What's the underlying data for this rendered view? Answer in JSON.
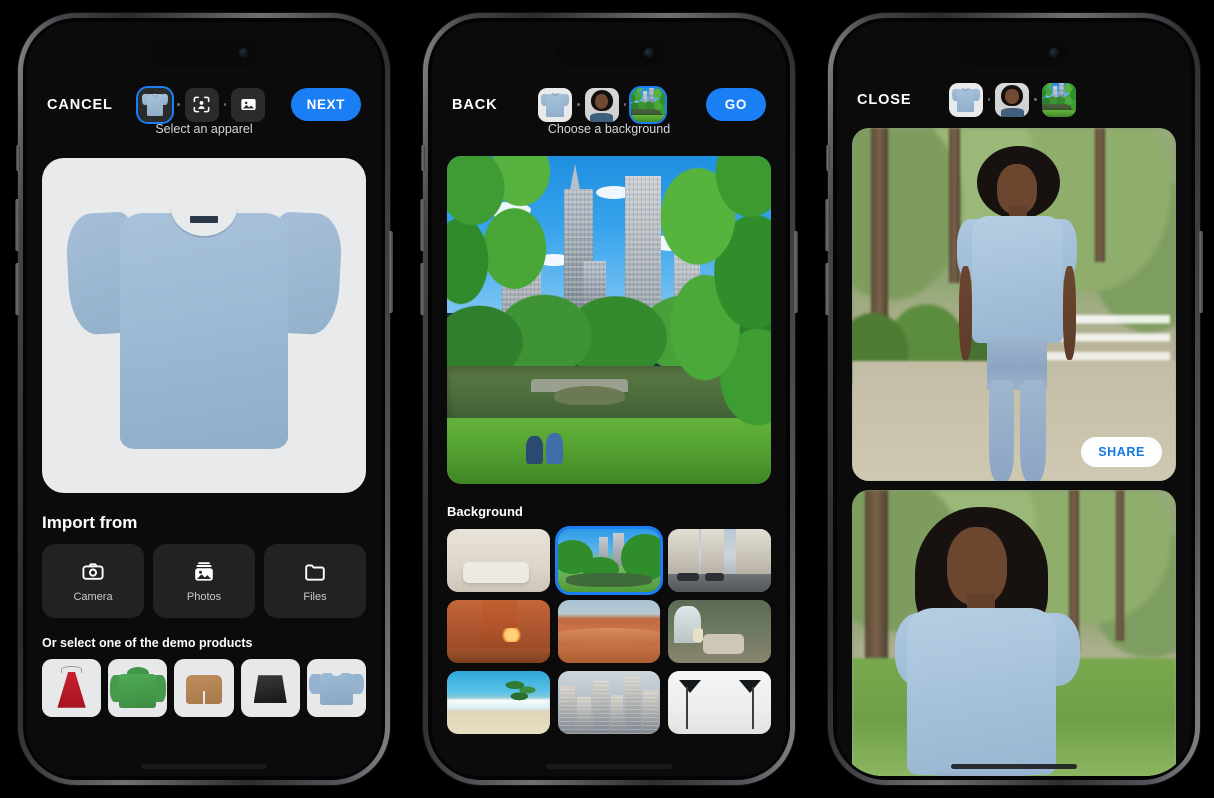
{
  "phones": [
    {
      "id": "apparel-select",
      "topbar": {
        "left_button": "CANCEL",
        "right_button": "NEXT",
        "caption": "Select an apparel",
        "steps": [
          {
            "name": "apparel",
            "selected": true,
            "icon": "tshirt-thumbnail"
          },
          {
            "name": "model",
            "selected": false,
            "icon": "person-frame-icon"
          },
          {
            "name": "background",
            "selected": false,
            "icon": "photo-icon"
          }
        ]
      },
      "preview": {
        "label": "blue t-shirt preview",
        "color": "#9dbad4",
        "card_bg": "#e9eaec"
      },
      "import": {
        "title": "Import from",
        "options": [
          {
            "label": "Camera",
            "icon": "camera-icon"
          },
          {
            "label": "Photos",
            "icon": "photos-icon"
          },
          {
            "label": "Files",
            "icon": "folder-icon"
          }
        ]
      },
      "demo": {
        "title": "Or select one of the demo products",
        "items": [
          {
            "label": "red dress",
            "kind": "dress"
          },
          {
            "label": "green hoodie",
            "kind": "hoodie"
          },
          {
            "label": "tan shorts",
            "kind": "shorts"
          },
          {
            "label": "black skirt",
            "kind": "skirt"
          },
          {
            "label": "blue t-shirt",
            "kind": "tee"
          }
        ]
      }
    },
    {
      "id": "background-select",
      "topbar": {
        "left_button": "BACK",
        "right_button": "GO",
        "caption": "Choose a background",
        "steps": [
          {
            "name": "apparel",
            "selected": false,
            "icon": "tshirt-thumbnail"
          },
          {
            "name": "model",
            "selected": false,
            "icon": "model-thumbnail"
          },
          {
            "name": "background",
            "selected": true,
            "icon": "park-thumbnail"
          }
        ]
      },
      "preview": {
        "label": "city park with lake and skyline"
      },
      "grid": {
        "title": "Background",
        "items": [
          {
            "label": "living room",
            "kind": "living",
            "selected": false
          },
          {
            "label": "city park",
            "kind": "park2",
            "selected": true
          },
          {
            "label": "european street",
            "kind": "street",
            "selected": false
          },
          {
            "label": "italian alley",
            "kind": "italy",
            "selected": false
          },
          {
            "label": "desert dunes",
            "kind": "desert",
            "selected": false
          },
          {
            "label": "green living room",
            "kind": "green",
            "selected": false
          },
          {
            "label": "tropical beach",
            "kind": "beach",
            "selected": false
          },
          {
            "label": "city skyscrapers",
            "kind": "city",
            "selected": false
          },
          {
            "label": "photo studio",
            "kind": "studio",
            "selected": false
          }
        ]
      }
    },
    {
      "id": "result-view",
      "topbar": {
        "left_button": "CLOSE",
        "right_button": "",
        "caption": "",
        "steps": [
          {
            "name": "apparel",
            "selected": false,
            "icon": "tshirt-thumbnail"
          },
          {
            "name": "model",
            "selected": false,
            "icon": "model-thumbnail"
          },
          {
            "name": "background",
            "selected": false,
            "icon": "park-thumbnail"
          }
        ]
      },
      "results": [
        {
          "label": "full body model wearing blue t-shirt in park",
          "share_label": "SHARE"
        },
        {
          "label": "portrait of model wearing blue t-shirt in park",
          "share_label": ""
        }
      ]
    }
  ],
  "colors": {
    "accent": "#1a7ef5",
    "screen_bg": "#0b0b0c",
    "tile_bg": "#212224",
    "share_text": "#1577e0",
    "shirt_blue": "#9dbad4"
  }
}
